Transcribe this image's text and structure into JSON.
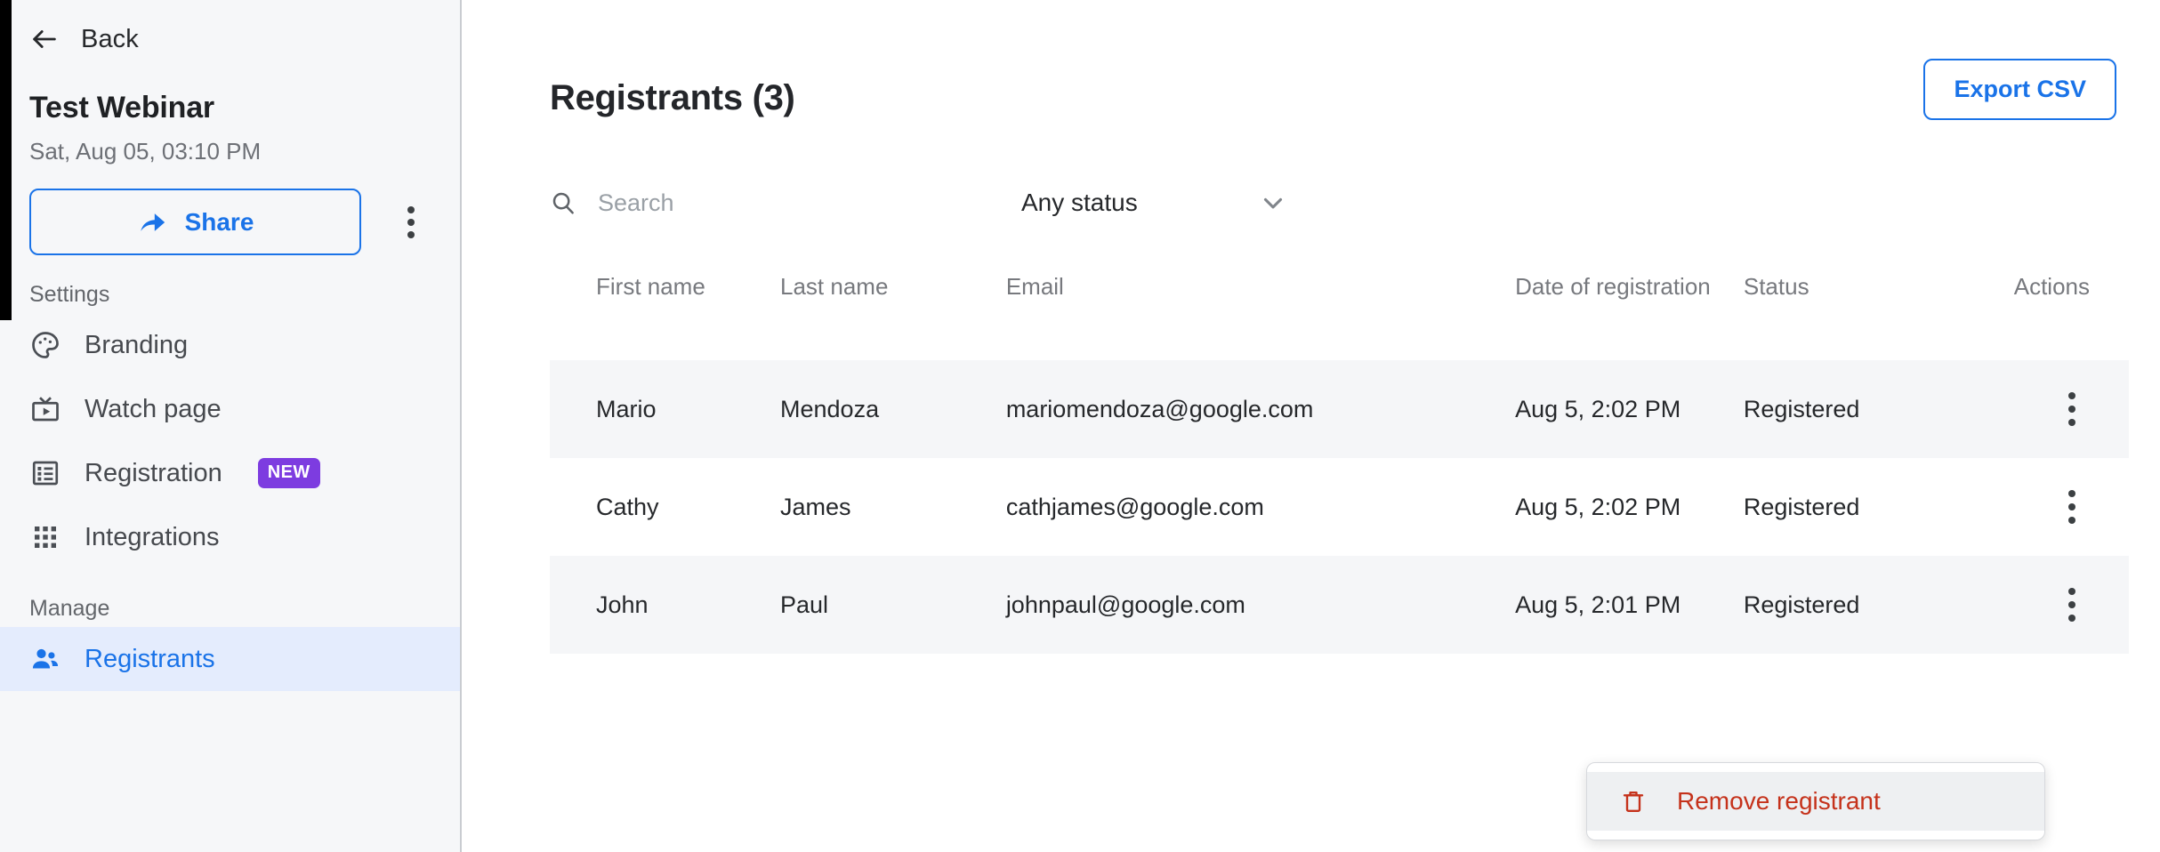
{
  "sidebar": {
    "back_label": "Back",
    "webinar_title": "Test Webinar",
    "webinar_date": "Sat, Aug 05, 03:10 PM",
    "share_label": "Share",
    "sections": {
      "settings_label": "Settings",
      "manage_label": "Manage"
    },
    "items": [
      {
        "label": "Branding",
        "icon": "palette-icon",
        "badge": ""
      },
      {
        "label": "Watch page",
        "icon": "tv-icon",
        "badge": ""
      },
      {
        "label": "Registration",
        "icon": "list-icon",
        "badge": "NEW"
      },
      {
        "label": "Integrations",
        "icon": "grid-icon",
        "badge": ""
      },
      {
        "label": "Registrants",
        "icon": "people-icon",
        "badge": ""
      }
    ]
  },
  "main": {
    "page_title": "Registrants (3)",
    "export_label": "Export CSV",
    "search": {
      "placeholder": "Search",
      "value": "",
      "icon": "search-icon"
    },
    "status_filter": {
      "selected": "Any status",
      "icon": "chevron-down-icon"
    },
    "table": {
      "headers": {
        "first_name": "First name",
        "last_name": "Last name",
        "email": "Email",
        "date": "Date of registration",
        "status": "Status",
        "actions": "Actions"
      },
      "rows": [
        {
          "first_name": "Mario",
          "last_name": "Mendoza",
          "email": "mariomendoza@google.com",
          "date": "Aug 5, 2:02 PM",
          "status": "Registered"
        },
        {
          "first_name": "Cathy",
          "last_name": "James",
          "email": "cathjames@google.com",
          "date": "Aug 5, 2:02 PM",
          "status": "Registered"
        },
        {
          "first_name": "John",
          "last_name": "Paul",
          "email": "johnpaul@google.com",
          "date": "Aug 5, 2:01 PM",
          "status": "Registered"
        }
      ]
    },
    "context_menu": {
      "remove_label": "Remove registrant",
      "icon": "trash-icon"
    }
  },
  "colors": {
    "accent_blue": "#1a73e8",
    "badge_purple": "#7d3ce0",
    "danger_red": "#c5321b",
    "sidebar_bg": "#f6f7f9",
    "row_shade": "#f5f6f8",
    "active_nav_bg": "#e4ecfd"
  }
}
